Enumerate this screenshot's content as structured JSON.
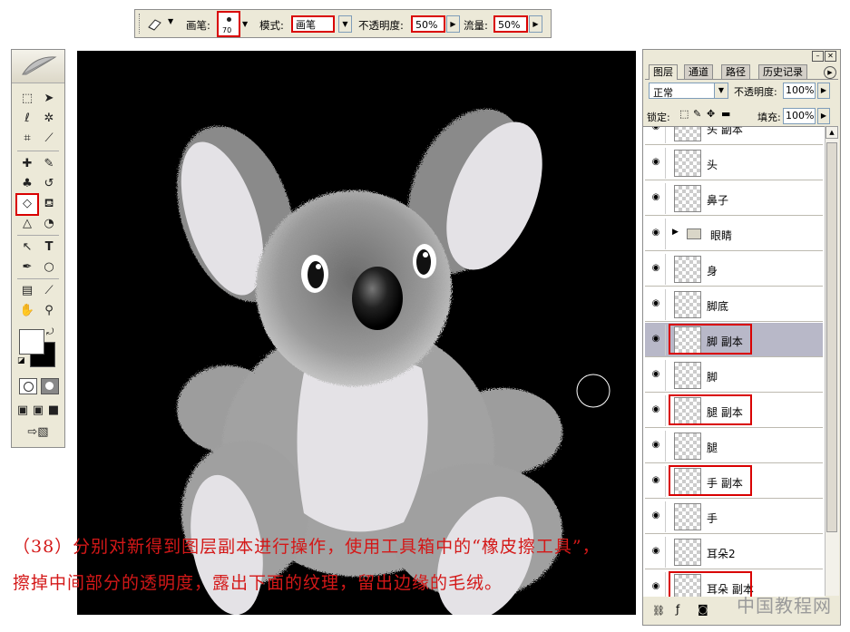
{
  "options_bar": {
    "brush_label": "画笔:",
    "brush_size": "70",
    "mode_label": "模式:",
    "mode_value": "画笔",
    "opacity_label": "不透明度:",
    "opacity_value": "50%",
    "flow_label": "流量:",
    "flow_value": "50%"
  },
  "layers_panel": {
    "tabs": [
      "图层",
      "通道",
      "路径",
      "历史记录"
    ],
    "blend_mode": "正常",
    "opacity_label": "不透明度:",
    "opacity_value": "100%",
    "lock_label": "锁定:",
    "fill_label": "填充:",
    "fill_value": "100%",
    "layers": [
      {
        "name": "头 副本",
        "highlighted": false
      },
      {
        "name": "头",
        "highlighted": false
      },
      {
        "name": "鼻子",
        "highlighted": false
      },
      {
        "name": "眼睛",
        "highlighted": false,
        "group": true
      },
      {
        "name": "身",
        "highlighted": false
      },
      {
        "name": "脚底",
        "highlighted": false
      },
      {
        "name": "脚 副本",
        "highlighted": true,
        "selected": true
      },
      {
        "name": "脚",
        "highlighted": false
      },
      {
        "name": "腿 副本",
        "highlighted": true
      },
      {
        "name": "腿",
        "highlighted": false
      },
      {
        "name": "手 副本",
        "highlighted": true
      },
      {
        "name": "手",
        "highlighted": false
      },
      {
        "name": "耳朵2",
        "highlighted": false
      },
      {
        "name": "耳朵 副本",
        "highlighted": true
      }
    ]
  },
  "caption": {
    "line1": "（38）分别对新得到图层副本进行操作，使用工具箱中的“橡皮擦工具”，",
    "line2": "擦掉中间部分的透明度，露出下面的纹理，留出边缘的毛绒。"
  },
  "watermark": "中国教程网",
  "colors": {
    "highlight_red": "#d90000",
    "caption_red": "#d41818",
    "panel_bg": "#ece9d8",
    "canvas_bg": "#000000"
  }
}
